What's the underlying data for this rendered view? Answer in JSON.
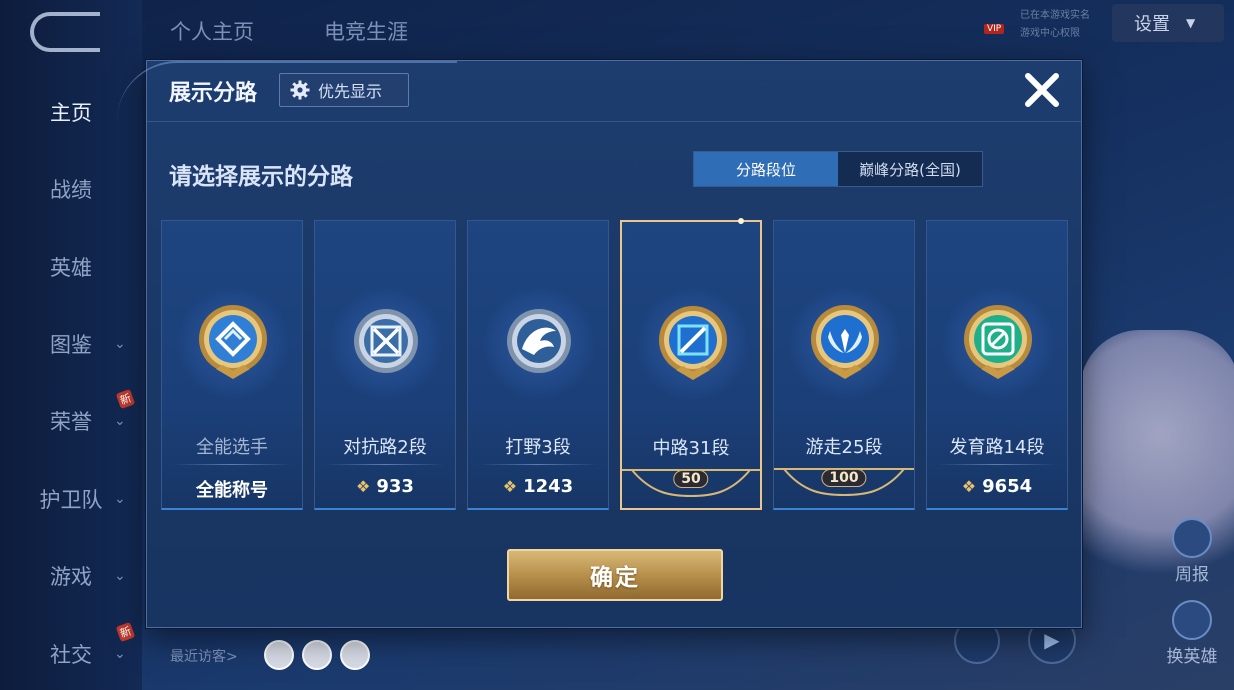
{
  "background": {
    "sidebar": [
      {
        "label": "主页",
        "active": true,
        "chevron": false,
        "new": false
      },
      {
        "label": "战绩",
        "active": false,
        "chevron": false,
        "new": false
      },
      {
        "label": "英雄",
        "active": false,
        "chevron": false,
        "new": false
      },
      {
        "label": "图鉴",
        "active": false,
        "chevron": true,
        "new": false
      },
      {
        "label": "荣誉",
        "active": false,
        "chevron": true,
        "new": true
      },
      {
        "label": "护卫队",
        "active": false,
        "chevron": true,
        "new": false
      },
      {
        "label": "游戏",
        "active": false,
        "chevron": true,
        "new": false
      },
      {
        "label": "社交",
        "active": false,
        "chevron": true,
        "new": true
      }
    ],
    "new_tag": "新",
    "top_tabs": [
      "个人主页",
      "电竞生涯"
    ],
    "settings_label": "设置",
    "vip_label": "VIP",
    "vip_line1": "已在本游戏实名",
    "vip_line2": "游戏中心权限",
    "visitors_label": "最近访客>",
    "right_buttons": [
      "周报",
      "换英雄"
    ]
  },
  "dialog": {
    "title": "展示分路",
    "priority_label": "优先显示",
    "subtitle": "请选择展示的分路",
    "tabs": [
      {
        "label": "分路段位",
        "active": true
      },
      {
        "label": "巅峰分路(全国)",
        "active": false
      }
    ],
    "cards": [
      {
        "name": "全能选手",
        "stat": "全能称号",
        "stat_type": "text",
        "emblem": "all-round-emblem",
        "selected": false,
        "dim": true
      },
      {
        "name": "对抗路2段",
        "stat": "933",
        "stat_type": "score",
        "emblem": "clash-lane-emblem",
        "selected": false,
        "dim": false
      },
      {
        "name": "打野3段",
        "stat": "1243",
        "stat_type": "score",
        "emblem": "jungle-emblem",
        "selected": false,
        "dim": false
      },
      {
        "name": "中路31段",
        "stat": "50",
        "stat_type": "rank",
        "emblem": "mid-lane-emblem",
        "selected": true,
        "dim": false
      },
      {
        "name": "游走25段",
        "stat": "100",
        "stat_type": "rank",
        "emblem": "roam-emblem",
        "selected": false,
        "dim": false
      },
      {
        "name": "发育路14段",
        "stat": "9654",
        "stat_type": "score",
        "emblem": "farm-lane-emblem",
        "selected": false,
        "dim": false
      }
    ],
    "confirm_label": "确定"
  },
  "colors": {
    "accent_blue": "#2f6db6",
    "gold": "#d8b877",
    "selected_border": "#e8c68c"
  }
}
